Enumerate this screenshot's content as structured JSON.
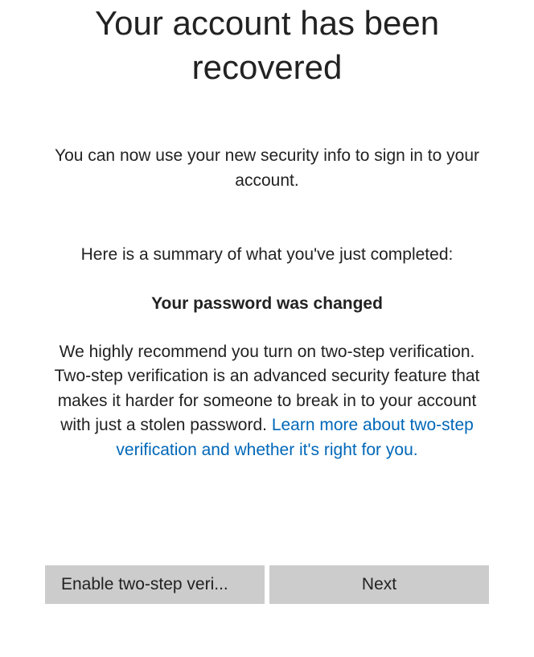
{
  "title": "Your account has been recovered",
  "intro": "You can now use your new security info to sign in to your account.",
  "summary_label": "Here is a summary of what you've just completed:",
  "password_changed": "Your password was changed",
  "recommend": "We highly recommend you turn on two-step verification. Two-step verification is an advanced security feature that makes it harder for someone to break in to your account with just a stolen password.",
  "learn_link": "Learn more about two-step verification and whether it's right for you.",
  "buttons": {
    "enable_label": "Enable two-step veri...",
    "next_label": "Next"
  }
}
